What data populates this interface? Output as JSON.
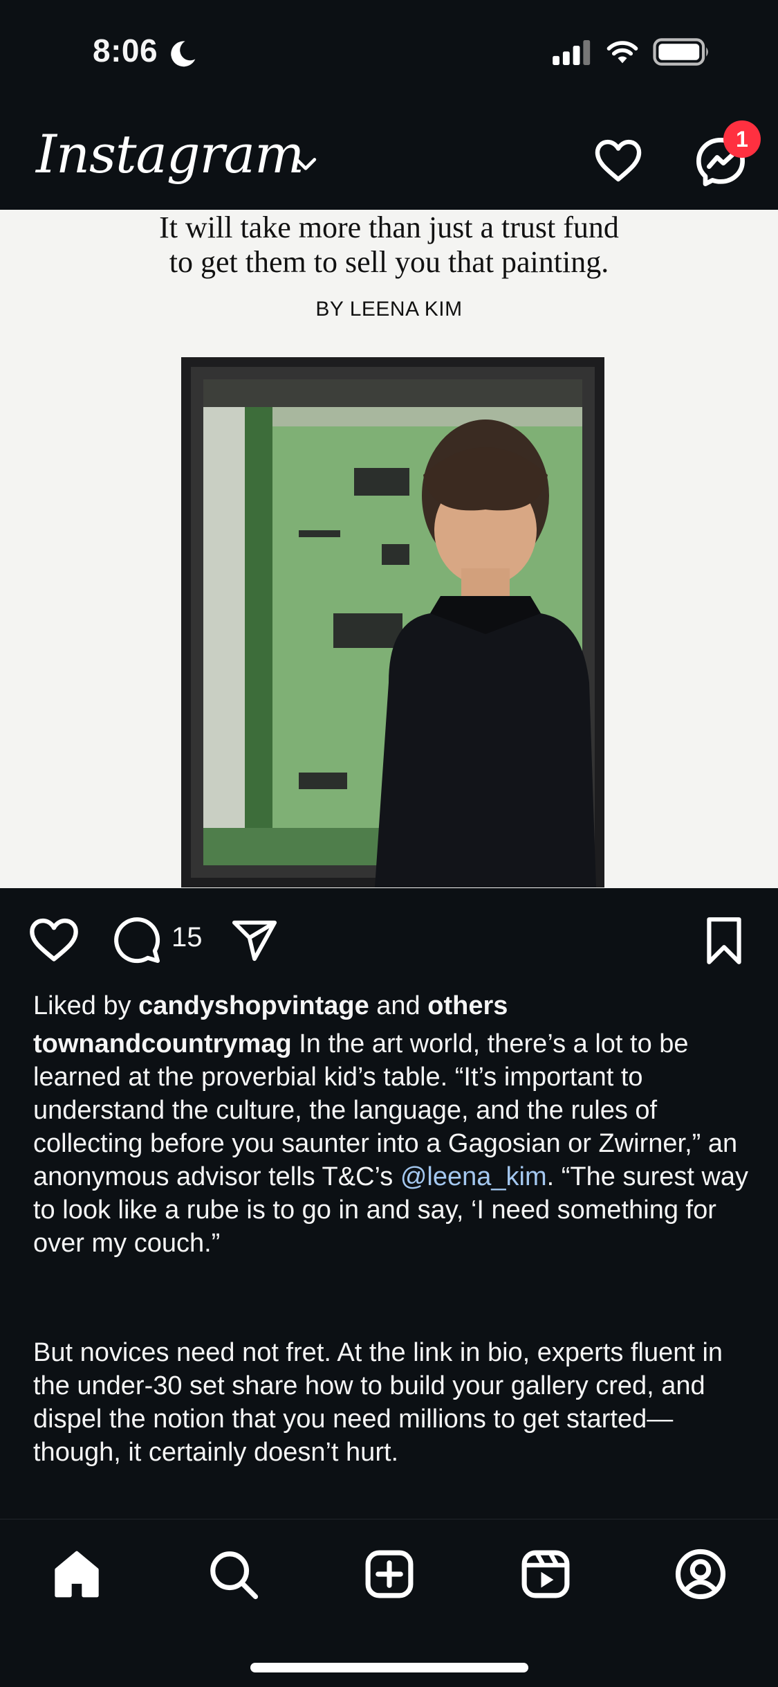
{
  "status_bar": {
    "time": "8:06"
  },
  "header": {
    "logo_text": "Instagram",
    "notification_badge": "1"
  },
  "post": {
    "image_headline_line1": "It will take more than just a trust fund",
    "image_headline_line2": "to get them to sell you that painting.",
    "image_byline": "BY LEENA KIM",
    "comment_count": "15",
    "liked_by_prefix": "Liked by ",
    "liked_by_user": "candyshopvintage",
    "liked_by_and": " and ",
    "liked_by_others": "others",
    "author": "townandcountrymag",
    "caption_part1": " In the art world, there’s a lot to be learned at the proverbial kid’s table. “It’s important to understand the culture, the language, and the rules of collecting before you saunter into a Gagosian or Zwirner,” an anonymous advisor tells T&C’s ",
    "caption_mention": "@leena_kim",
    "caption_part2": ". “The surest way to look like a rube is to go in and say, ‘I need something for over my couch.”",
    "caption_paragraph2": "But novices need not fret. At the link in bio, experts fluent in the under-30 set share how to build your gallery cred, and dispel the notion that you need millions to get started—though, it certainly doesn’t hurt."
  },
  "icons": {
    "status": [
      "moon-icon",
      "signal-icon",
      "wifi-icon",
      "battery-icon"
    ],
    "header": [
      "chevron-down-icon",
      "heart-icon",
      "messenger-icon"
    ],
    "actions": [
      "like-icon",
      "comment-icon",
      "share-icon",
      "bookmark-icon"
    ],
    "tabs": [
      "home-icon",
      "search-icon",
      "create-icon",
      "reels-icon",
      "profile-icon"
    ]
  },
  "colors": {
    "background": "#0c1014",
    "badge": "#ff3040",
    "mention": "#a4c8f0"
  }
}
